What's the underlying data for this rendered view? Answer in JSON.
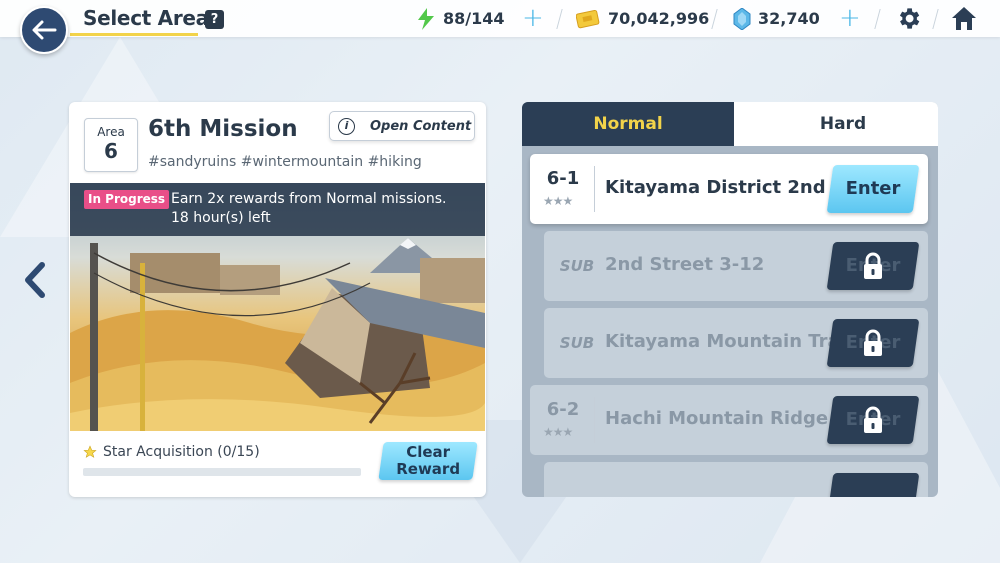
{
  "header": {
    "title": "Select Area",
    "help_label": "?",
    "stamina": "88/144",
    "gold": "70,042,996",
    "gems": "32,740"
  },
  "area_card": {
    "area_label": "Area",
    "area_number": "6",
    "mission_title": "6th Mission",
    "tags": "#sandyruins #wintermountain #hiking",
    "open_content_label": "Open Content",
    "status_badge": "In Progress",
    "bonus_line1": "Earn 2x rewards from Normal missions.",
    "bonus_line2": "18 hour(s) left",
    "star_acquisition": "Star Acquisition (0/15)",
    "star_progress": 0,
    "clear_reward_line1": "Clear",
    "clear_reward_line2": "Reward"
  },
  "stage_panel": {
    "tabs": [
      {
        "label": "Normal",
        "active": true
      },
      {
        "label": "Hard",
        "active": false
      }
    ],
    "stages": [
      {
        "code": "6-1",
        "name": "Kitayama District 2nd ...",
        "enter_label": "Enter",
        "locked": false,
        "sub": false
      },
      {
        "code": "SUB",
        "name": "2nd Street 3-12",
        "enter_label": "Enter",
        "locked": true,
        "sub": true
      },
      {
        "code": "SUB",
        "name": "Kitayama Mountain Trail",
        "enter_label": "Enter",
        "locked": true,
        "sub": true
      },
      {
        "code": "6-2",
        "name": "Hachi Mountain Ridge ...",
        "enter_label": "Enter",
        "locked": true,
        "sub": false
      }
    ]
  },
  "colors": {
    "navy": "#2b3e55",
    "accent_yellow": "#f2d34a",
    "button_cyan": "#5cc6f0",
    "badge_pink": "#e94f88"
  }
}
